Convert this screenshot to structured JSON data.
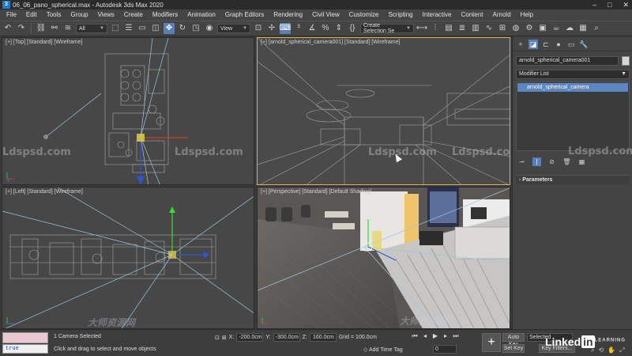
{
  "window": {
    "app_icon": "3ds-max-logo",
    "title": "06_06_pano_spherical.max - Autodesk 3ds Max 2020",
    "controls": [
      "–",
      "□",
      "✕"
    ]
  },
  "menu": [
    "File",
    "Edit",
    "Tools",
    "Group",
    "Views",
    "Create",
    "Modifiers",
    "Animation",
    "Graph Editors",
    "Rendering",
    "Civil View",
    "Customize",
    "Scripting",
    "Interactive",
    "Content",
    "Arnold",
    "Help"
  ],
  "toolbar": {
    "selection_filter": "All",
    "reference_coord": "View",
    "named_selection": "Create Selection Se"
  },
  "viewports": {
    "top_label": "[+] [Top] [Standard] [Wireframe]",
    "camera_label": "[+] [arnold_spherical_camera001] [Standard] [Wireframe]",
    "left_label": "[+] [Left] [Standard] [Wireframe]",
    "persp_label": "[+] [Perspective] [Standard] [Default Shading]"
  },
  "watermarks": {
    "site": "Ldspsd.com",
    "cn": "大师资源网"
  },
  "command_panel": {
    "object_name": "arnold_spherical_camera001",
    "modifier_list": "Modifier List",
    "stack_item": "arnold_spherical_camera",
    "rollout_title": "Parameters",
    "rollout_toggle": "-"
  },
  "status": {
    "maxscript_value": "true",
    "selection_message": "1 Camera Selected",
    "prompt": "Click and drag to select and move objects",
    "x_label": "X:",
    "x_value": "-200.0cm",
    "y_label": "Y:",
    "y_value": "-300.0cm",
    "z_label": "Z:",
    "z_value": "160.0cm",
    "grid": "Grid = 100.0cm",
    "add_time_tag": "Add Time Tag",
    "frame": "0",
    "auto_key": "Auto Key",
    "set_key": "Set Key",
    "selected": "Selected",
    "key_filters": "Key Filters...",
    "brand": "Linked",
    "brand_in": "in",
    "brand_learning": "LEARNING"
  }
}
